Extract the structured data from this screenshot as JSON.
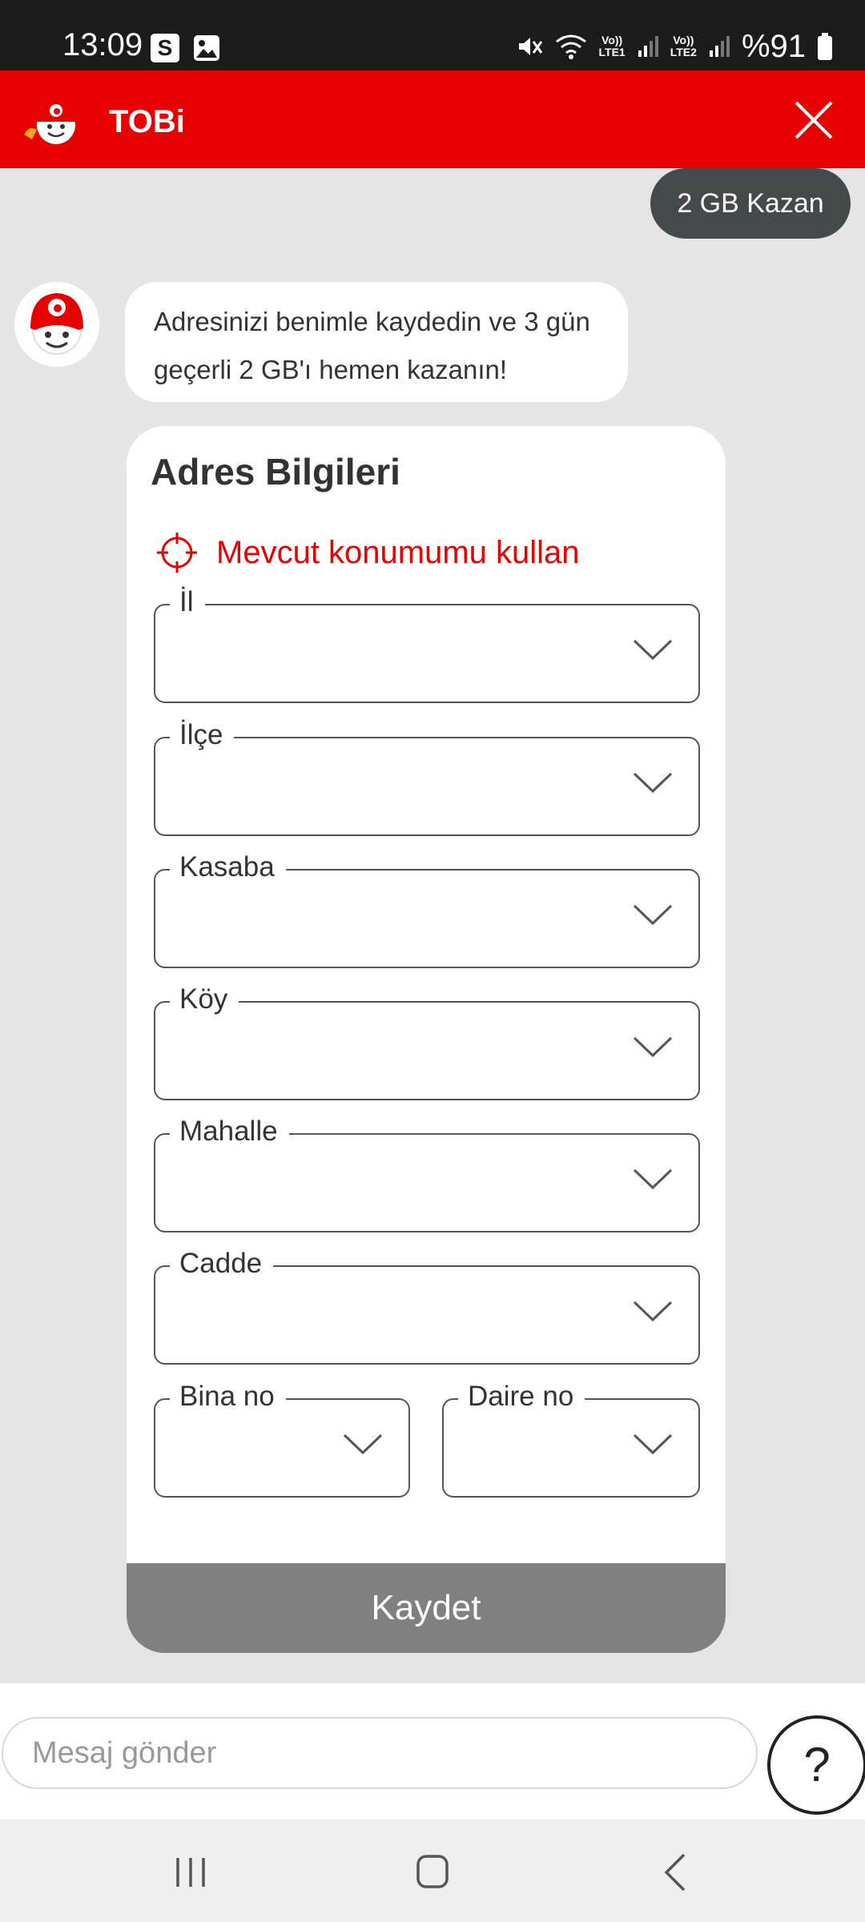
{
  "status_bar": {
    "time": "13:09",
    "s_icon": "S",
    "network1": [
      "Vo))",
      "LTE1"
    ],
    "network2": [
      "Vo))",
      "LTE2"
    ],
    "battery": "%91"
  },
  "header": {
    "title": "TOBi",
    "brand_color": "#e60000"
  },
  "chat": {
    "quick_reply": "2 GB Kazan",
    "bot_message": "Adresinizi benimle kaydedin ve 3 gün geçerli 2 GB'ı hemen kazanın!"
  },
  "form": {
    "title": "Adres Bilgileri",
    "use_location": "Mevcut konumumu kullan",
    "fields": {
      "il": "İl",
      "ilce": "İlçe",
      "kasaba": "Kasaba",
      "koy": "Köy",
      "mahalle": "Mahalle",
      "cadde": "Cadde",
      "bina_no": "Bina no",
      "daire_no": "Daire no"
    },
    "save_label": "Kaydet"
  },
  "input_bar": {
    "placeholder": "Mesaj gönder",
    "help_label": "?"
  },
  "icons": {
    "header": "tobi-logo-icon",
    "close": "close-icon",
    "location": "crosshair-icon",
    "chevron": "chevron-down-icon"
  }
}
